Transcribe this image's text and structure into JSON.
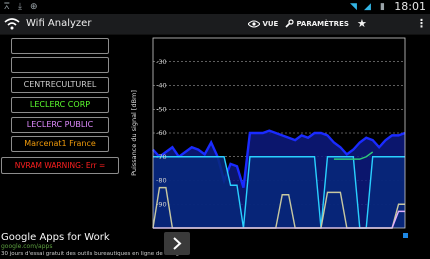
{
  "status": {
    "time": "18:01"
  },
  "app": {
    "title": "Wifi Analyzer"
  },
  "toolbar": {
    "view_label": "VUE",
    "settings_label": "PARAMÈTRES"
  },
  "sidebar": {
    "items": [
      {
        "label": "",
        "color": "#cfcfcf"
      },
      {
        "label": "",
        "color": "#cfcfcf"
      },
      {
        "label": "CENTRECULTUREL",
        "color": "#cfcfcf"
      },
      {
        "label": "LECLERC CORP",
        "color": "#5cff2e"
      },
      {
        "label": "LECLERC PUBLIC",
        "color": "#e08bff"
      },
      {
        "label": "Marcenat1 France",
        "color": "#f09a0a"
      }
    ],
    "warning": {
      "label": "NVRAM WARNING: Err =",
      "color": "#ff2020"
    }
  },
  "chart_data": {
    "type": "line",
    "ylabel": "Puissance du signal [dBm]",
    "ylim": [
      -100,
      -20
    ],
    "yticks": [
      -30,
      -40,
      -50,
      -60,
      -70,
      -80,
      -90
    ],
    "grid": true,
    "series": [
      {
        "color": "#1a2bff",
        "fill": "#0d1a80",
        "values": [
          -67,
          -70,
          -68,
          -66,
          -70,
          -68,
          -66,
          -67,
          -69,
          -64,
          -70,
          -80,
          -73,
          -74,
          -83,
          -60,
          -60,
          -60,
          -59,
          -60,
          -61,
          -62,
          -63,
          -61,
          -62,
          -60,
          -60,
          -61,
          -64,
          -66,
          -69,
          -67,
          -64,
          -62,
          -63,
          -66,
          -63,
          -61,
          -61,
          -60
        ]
      },
      {
        "color": "#29d0ff",
        "fill": "#07287a",
        "values": [
          -70,
          -70,
          -70,
          -70,
          -70,
          -70,
          -70,
          -70,
          -70,
          -70,
          -70,
          -70,
          -82,
          -82,
          -100,
          -70,
          -70,
          -70,
          -70,
          -70,
          -70,
          -70,
          -70,
          -70,
          -70,
          -70,
          -100,
          -70,
          -70,
          -70,
          -70,
          -70,
          -100,
          -100,
          -70,
          -70,
          -70,
          -70,
          -70,
          -70
        ]
      },
      {
        "color": "#2ec97a",
        "values": [
          null,
          null,
          null,
          null,
          null,
          null,
          null,
          null,
          null,
          null,
          null,
          null,
          null,
          null,
          null,
          null,
          null,
          null,
          null,
          null,
          null,
          null,
          null,
          null,
          null,
          null,
          null,
          null,
          -71,
          -71,
          -71,
          -71,
          -71,
          -70,
          -68,
          null,
          null,
          null,
          null,
          null
        ]
      },
      {
        "color": "#c8c8a0",
        "values": [
          -100,
          -83,
          -83,
          -100,
          -100,
          -100,
          -100,
          -100,
          -100,
          -100,
          -100,
          -100,
          -100,
          -100,
          -100,
          -100,
          -100,
          -100,
          -100,
          -100,
          -86,
          -86,
          -100,
          -100,
          -100,
          -100,
          -100,
          -85,
          -85,
          -85,
          -100,
          -100,
          -100,
          -100,
          -100,
          -100,
          -100,
          -100,
          -90,
          -90
        ]
      },
      {
        "color": "#e0b0ff",
        "values": [
          -100,
          -100,
          -100,
          -100,
          -100,
          -100,
          -100,
          -100,
          -100,
          -100,
          -100,
          -100,
          -100,
          -100,
          -100,
          -100,
          -100,
          -100,
          -100,
          -100,
          -100,
          -100,
          -100,
          -100,
          -100,
          -100,
          -100,
          -100,
          -100,
          -100,
          -100,
          -100,
          -100,
          -100,
          -100,
          -100,
          -100,
          -100,
          -93,
          -93
        ]
      }
    ]
  },
  "ad": {
    "title": "Google Apps for Work",
    "url": "google.com/apps",
    "text": "30 jours d'essai gratuit des outils bureautiques en ligne de Google !"
  }
}
